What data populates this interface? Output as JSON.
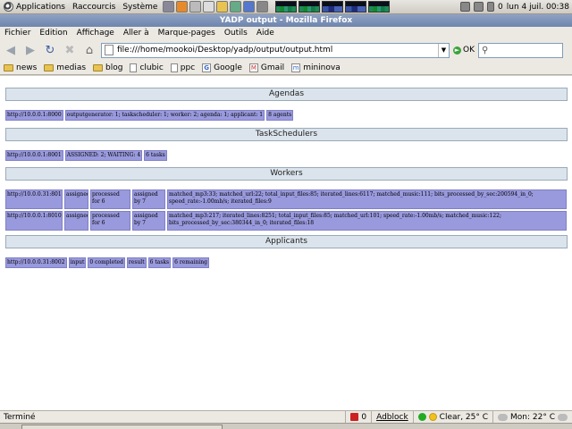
{
  "panel": {
    "applications": "Applications",
    "shortcuts": "Raccourcis",
    "system": "Système",
    "clock": "lun  4 juil. 00:38",
    "volume_value": "0"
  },
  "window": {
    "title": "YADP output - Mozilla Firefox"
  },
  "menubar": [
    "Fichier",
    "Edition",
    "Affichage",
    "Aller à",
    "Marque-pages",
    "Outils",
    "Aide"
  ],
  "navbar": {
    "url": "file:///home/mookoi/Desktop/yadp/output/output.html",
    "go_label": "OK",
    "search_value": ""
  },
  "bookmarks": [
    {
      "label": "news",
      "icon": "folder-icon"
    },
    {
      "label": "medias",
      "icon": "folder-icon"
    },
    {
      "label": "blog",
      "icon": "folder-icon"
    },
    {
      "label": "clubic",
      "icon": "page-icon"
    },
    {
      "label": "ppc",
      "icon": "page-icon"
    },
    {
      "label": "Google",
      "icon": "google-icon"
    },
    {
      "label": "Gmail",
      "icon": "gmail-icon"
    },
    {
      "label": "mininova",
      "icon": "mininova-icon"
    }
  ],
  "page": {
    "agendas": {
      "title": "Agendas",
      "cells": [
        "http://10.0.0.1:8000",
        "outputgenerator: 1; taskscheduler: 1; worker: 2; agenda: 1; applicant: 1",
        "8 agents"
      ]
    },
    "taskschedulers": {
      "title": "TaskSchedulers",
      "cells": [
        "http://10.0.0.1:8001",
        "ASSIGNED: 2; WAITING: 4",
        "6 tasks"
      ]
    },
    "workers": {
      "title": "Workers",
      "rows": [
        [
          "http://10.0.0.31:8010",
          "assigned",
          "processed for 6",
          "assigned by 7",
          "matched_mp3:33; matched_url:22; total_input_files:85; iterated_lines:6117; matched_music:111; bits_processed_by_sec:200594_in_0; speed_rate:-1.00mb/s; iterated_files:9"
        ],
        [
          "http://10.0.0.1:8010",
          "assigned",
          "processed for 6",
          "assigned by 7",
          "matched_mp3:217; iterated_lines:8251; total_input_files:85; matched_url:101; speed_rate:-1.00mb/s; matched_music:122; bits_processed_by_sec:380344_in_0; iterated_files:18"
        ]
      ]
    },
    "applicants": {
      "title": "Applicants",
      "cells": [
        "http://10.0.0.31:8002",
        "input",
        "0 completed",
        "result",
        "6 tasks",
        "6 remaining"
      ]
    }
  },
  "statusbar": {
    "status": "Terminé",
    "mail_count": "0",
    "adblock": "Adblock",
    "weather1": "Clear, 25° C",
    "weather2": "Mon: 22° C"
  }
}
